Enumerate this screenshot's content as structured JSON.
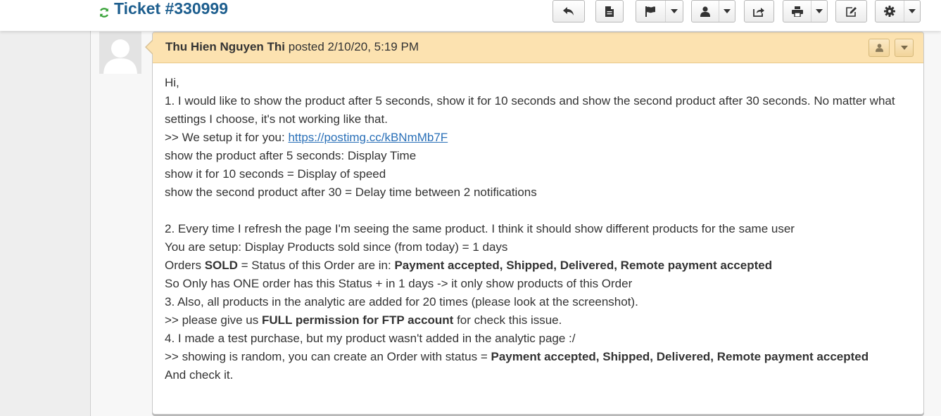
{
  "header": {
    "ticket_title": "Ticket #330999",
    "icons": [
      "refresh-icon",
      "reply-icon",
      "note-icon",
      "flag-icon",
      "user-icon",
      "share-icon",
      "print-icon",
      "edit-icon",
      "gear-icon",
      "caret-down-icon"
    ]
  },
  "entry": {
    "poster": "Thu Hien Nguyen Thi",
    "posted_text": "posted 2/10/20, 5:19 PM",
    "lines": {
      "greeting": "Hi,",
      "q1": "1. I would like to show the product after 5 seconds, show it for 10 seconds and show the second product after 30 seconds. No matter what settings I choose, it's not working like that.",
      "r1_prefix": ">> We setup it for you: ",
      "r1_link": "https://postimg.cc/kBNmMb7F",
      "r1_a": "show the product after 5 seconds: Display Time",
      "r1_b": "show it for 10 seconds = Display of speed",
      "r1_c": "show the second product after 30 = Delay time between 2 notifications",
      "q2": "2. Every time I refresh the page I'm seeing the same product. I think it should show different products for the same user",
      "r2_a": "You are setup: Display Products sold since (from today) = 1 days",
      "r2_b_pre": "Orders ",
      "r2_b_bold1": "SOLD",
      "r2_b_mid": " = Status of this Order are in: ",
      "r2_b_bold2": "Payment accepted, Shipped, Delivered, Remote payment accepted",
      "r2_c": "So Only has ONE order has this Status + in 1 days -> it only show products of this Order",
      "q3": "3. Also, all products in the analytic are added for 20 times (please look at the screenshot).",
      "r3_pre": ">> please give us ",
      "r3_bold": "FULL permission for FTP account",
      "r3_post": " for check this issue.",
      "q4": "4. I made a test purchase, but my product wasn't added in the analytic page :/",
      "r4_pre": ">> showing is random, you can create an Order with status = ",
      "r4_bold": "Payment accepted, Shipped, Delivered, Remote payment accepted",
      "closing": "And check it."
    }
  },
  "colors": {
    "title_blue": "#1d5e8e",
    "refresh_green": "#3aa33a",
    "entry_header_bg": "#fce2b0",
    "link_blue": "#2a70b8"
  }
}
